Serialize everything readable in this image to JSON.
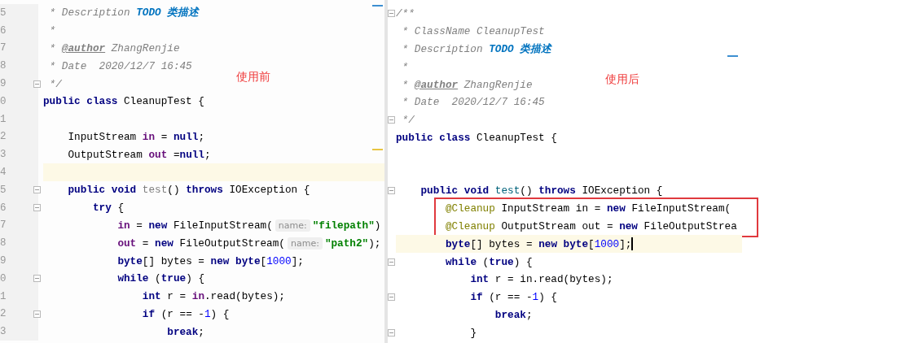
{
  "panes": [
    {
      "label": "使用前",
      "lines": [
        {
          "number": "5",
          "tokens": [
            {
              "kind": "comment",
              "text": " * Description "
            },
            {
              "kind": "todo",
              "text": "TODO 类描述"
            }
          ]
        },
        {
          "number": "6",
          "tokens": [
            {
              "kind": "comment",
              "text": " *"
            }
          ]
        },
        {
          "number": "7",
          "tokens": [
            {
              "kind": "comment",
              "text": " * "
            },
            {
              "kind": "tag",
              "text": "@author"
            },
            {
              "kind": "comment",
              "text": " ZhangRenjie"
            }
          ]
        },
        {
          "number": "8",
          "tokens": [
            {
              "kind": "comment",
              "text": " * Date  2020/12/7 16:45"
            }
          ]
        },
        {
          "number": "9",
          "fold": true,
          "tokens": [
            {
              "kind": "comment",
              "text": " */"
            }
          ]
        },
        {
          "number": "0",
          "tokens": [
            {
              "kind": "keyword",
              "text": "public class "
            },
            {
              "kind": "plain",
              "text": "CleanupTest {"
            }
          ]
        },
        {
          "number": "1",
          "kind": "blank"
        },
        {
          "number": "2",
          "tokens": [
            {
              "kind": "plain",
              "text": "    InputStream "
            },
            {
              "kind": "field",
              "text": "in"
            },
            {
              "kind": "plain",
              "text": " = "
            },
            {
              "kind": "keyword",
              "text": "null"
            },
            {
              "kind": "plain",
              "text": ";"
            }
          ]
        },
        {
          "number": "3",
          "tokens": [
            {
              "kind": "plain",
              "text": "    OutputStream "
            },
            {
              "kind": "field",
              "text": "out"
            },
            {
              "kind": "plain",
              "text": " ="
            },
            {
              "kind": "keyword",
              "text": "null"
            },
            {
              "kind": "plain",
              "text": ";"
            }
          ]
        },
        {
          "number": "4",
          "kind": "blank",
          "highlighted": true
        },
        {
          "number": "5",
          "fold": true,
          "tokens": [
            {
              "kind": "keyword",
              "text": "    public void "
            },
            {
              "kind": "unused",
              "text": "test"
            },
            {
              "kind": "plain",
              "text": "() "
            },
            {
              "kind": "keyword",
              "text": "throws "
            },
            {
              "kind": "plain",
              "text": "IOException {"
            }
          ]
        },
        {
          "number": "6",
          "fold": true,
          "tokens": [
            {
              "kind": "keyword",
              "text": "        try "
            },
            {
              "kind": "plain",
              "text": "{"
            }
          ]
        },
        {
          "number": "7",
          "tokens": [
            {
              "kind": "field",
              "text": "            in"
            },
            {
              "kind": "plain",
              "text": " = "
            },
            {
              "kind": "keyword",
              "text": "new "
            },
            {
              "kind": "plain",
              "text": "FileInputStream("
            },
            {
              "kind": "hint",
              "text": "name:"
            },
            {
              "kind": "string",
              "text": "\"filepath\""
            },
            {
              "kind": "plain",
              "text": ")"
            }
          ]
        },
        {
          "number": "8",
          "tokens": [
            {
              "kind": "field",
              "text": "            out"
            },
            {
              "kind": "plain",
              "text": " = "
            },
            {
              "kind": "keyword",
              "text": "new "
            },
            {
              "kind": "plain",
              "text": "FileOutputStream("
            },
            {
              "kind": "hint",
              "text": "name:"
            },
            {
              "kind": "string",
              "text": "\"path2\""
            },
            {
              "kind": "plain",
              "text": ");"
            }
          ]
        },
        {
          "number": "9",
          "tokens": [
            {
              "kind": "keyword",
              "text": "            byte"
            },
            {
              "kind": "plain",
              "text": "[] bytes = "
            },
            {
              "kind": "keyword",
              "text": "new byte"
            },
            {
              "kind": "plain",
              "text": "["
            },
            {
              "kind": "number",
              "text": "1000"
            },
            {
              "kind": "plain",
              "text": "];"
            }
          ]
        },
        {
          "number": "0",
          "fold": true,
          "tokens": [
            {
              "kind": "keyword",
              "text": "            while "
            },
            {
              "kind": "plain",
              "text": "("
            },
            {
              "kind": "keyword",
              "text": "true"
            },
            {
              "kind": "plain",
              "text": ") {"
            }
          ]
        },
        {
          "number": "1",
          "tokens": [
            {
              "kind": "keyword",
              "text": "                int "
            },
            {
              "kind": "plain",
              "text": "r = "
            },
            {
              "kind": "field",
              "text": "in"
            },
            {
              "kind": "plain",
              "text": ".read(bytes);"
            }
          ]
        },
        {
          "number": "2",
          "fold": true,
          "tokens": [
            {
              "kind": "keyword",
              "text": "                if "
            },
            {
              "kind": "plain",
              "text": "(r == -"
            },
            {
              "kind": "number",
              "text": "1"
            },
            {
              "kind": "plain",
              "text": ") {"
            }
          ]
        },
        {
          "number": "3",
          "tokens": [
            {
              "kind": "keyword",
              "text": "                    break"
            },
            {
              "kind": "plain",
              "text": ";"
            }
          ]
        }
      ]
    },
    {
      "label": "使用后",
      "lines": [
        {
          "fold": true,
          "tokens": [
            {
              "kind": "comment",
              "text": "/**"
            }
          ]
        },
        {
          "tokens": [
            {
              "kind": "comment",
              "text": " * ClassName CleanupTest"
            }
          ]
        },
        {
          "tokens": [
            {
              "kind": "comment",
              "text": " * Description "
            },
            {
              "kind": "todo",
              "text": "TODO 类描述"
            }
          ]
        },
        {
          "tokens": [
            {
              "kind": "comment",
              "text": " *"
            }
          ]
        },
        {
          "tokens": [
            {
              "kind": "comment",
              "text": " * "
            },
            {
              "kind": "tag",
              "text": "@author"
            },
            {
              "kind": "comment",
              "text": " ZhangRenjie"
            }
          ]
        },
        {
          "tokens": [
            {
              "kind": "comment",
              "text": " * Date  2020/12/7 16:45"
            }
          ]
        },
        {
          "fold": true,
          "tokens": [
            {
              "kind": "comment",
              "text": " */"
            }
          ]
        },
        {
          "tokens": [
            {
              "kind": "keyword",
              "text": "public class "
            },
            {
              "kind": "plain",
              "text": "CleanupTest {"
            }
          ]
        },
        {
          "kind": "blank"
        },
        {
          "kind": "blank"
        },
        {
          "fold": true,
          "tokens": [
            {
              "kind": "keyword",
              "text": "    public void "
            },
            {
              "kind": "method",
              "text": "test"
            },
            {
              "kind": "plain",
              "text": "() "
            },
            {
              "kind": "keyword",
              "text": "throws "
            },
            {
              "kind": "plain",
              "text": "IOException {"
            }
          ]
        },
        {
          "framed": true,
          "tokens": [
            {
              "kind": "annotation",
              "text": "        @Cleanup"
            },
            {
              "kind": "plain",
              "text": " InputStream in = "
            },
            {
              "kind": "keyword",
              "text": "new "
            },
            {
              "kind": "plain",
              "text": "FileInputStream("
            }
          ]
        },
        {
          "framed": true,
          "tokens": [
            {
              "kind": "annotation",
              "text": "        @Cleanup"
            },
            {
              "kind": "plain",
              "text": " OutputStream out = "
            },
            {
              "kind": "keyword",
              "text": "new "
            },
            {
              "kind": "plain",
              "text": "FileOutputStrea"
            }
          ]
        },
        {
          "highlighted": true,
          "caret": true,
          "tokens": [
            {
              "kind": "keyword",
              "text": "        byte"
            },
            {
              "kind": "plain",
              "text": "[] bytes = "
            },
            {
              "kind": "keyword",
              "text": "new byte"
            },
            {
              "kind": "plain",
              "text": "["
            },
            {
              "kind": "number",
              "text": "1000"
            },
            {
              "kind": "plain",
              "text": "];"
            }
          ]
        },
        {
          "fold": true,
          "tokens": [
            {
              "kind": "keyword",
              "text": "        while "
            },
            {
              "kind": "plain",
              "text": "("
            },
            {
              "kind": "keyword",
              "text": "true"
            },
            {
              "kind": "plain",
              "text": ") {"
            }
          ]
        },
        {
          "tokens": [
            {
              "kind": "keyword",
              "text": "            int "
            },
            {
              "kind": "plain",
              "text": "r = in.read(bytes);"
            }
          ]
        },
        {
          "fold": true,
          "tokens": [
            {
              "kind": "keyword",
              "text": "            if "
            },
            {
              "kind": "plain",
              "text": "(r == -"
            },
            {
              "kind": "number",
              "text": "1"
            },
            {
              "kind": "plain",
              "text": ") {"
            }
          ]
        },
        {
          "tokens": [
            {
              "kind": "keyword",
              "text": "                break"
            },
            {
              "kind": "plain",
              "text": ";"
            }
          ]
        },
        {
          "fold": true,
          "tokens": [
            {
              "kind": "plain",
              "text": "            }"
            }
          ]
        }
      ]
    }
  ]
}
